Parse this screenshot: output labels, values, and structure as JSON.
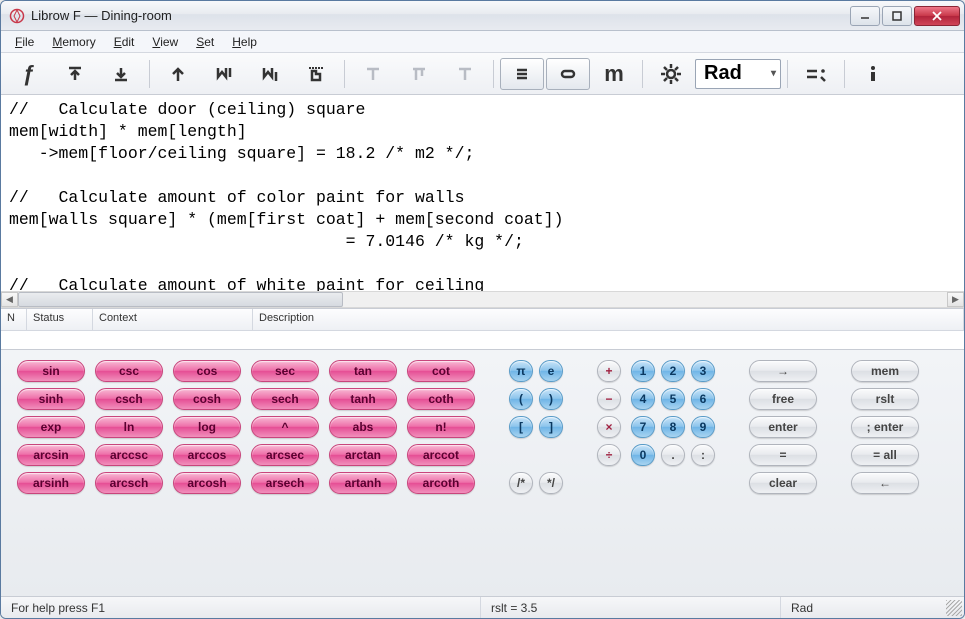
{
  "window": {
    "title": "Librow F — Dining-room"
  },
  "menu": {
    "file": "File",
    "memory": "Memory",
    "edit": "Edit",
    "view": "View",
    "set": "Set",
    "help": "Help"
  },
  "toolbar": {
    "angle_mode": "Rad"
  },
  "editor": {
    "text": "//   Calculate door (ceiling) square\nmem[width] * mem[length]\n   ->mem[floor/ceiling square] = 18.2 /* m2 */;\n\n//   Calculate amount of color paint for walls\nmem[walls square] * (mem[first coat] + mem[second coat])\n                                  = 7.0146 /* kg */;\n\n//   Calculate amount of white paint for ceiling"
  },
  "table": {
    "headers": {
      "n": "N",
      "status": "Status",
      "context": "Context",
      "description": "Description"
    }
  },
  "pad": {
    "r1": {
      "sin": "sin",
      "csc": "csc",
      "cos": "cos",
      "sec": "sec",
      "tan": "tan",
      "cot": "cot",
      "pi": "π",
      "e": "e",
      "plus": "+",
      "d1": "1",
      "d2": "2",
      "d3": "3",
      "arrow": "→",
      "mem": "mem"
    },
    "r2": {
      "sinh": "sinh",
      "csch": "csch",
      "cosh": "cosh",
      "sech": "sech",
      "tanh": "tanh",
      "coth": "coth",
      "lp": "(",
      "rp": ")",
      "minus": "−",
      "d4": "4",
      "d5": "5",
      "d6": "6",
      "free": "free",
      "rslt": "rslt"
    },
    "r3": {
      "exp": "exp",
      "ln": "ln",
      "log": "log",
      "pow": "^",
      "abs": "abs",
      "fact": "n!",
      "lb": "[",
      "rb": "]",
      "mul": "×",
      "d7": "7",
      "d8": "8",
      "d9": "9",
      "enter": "enter",
      "senter": "; enter"
    },
    "r4": {
      "arcsin": "arcsin",
      "arccsc": "arccsc",
      "arccos": "arccos",
      "arcsec": "arcsec",
      "arctan": "arctan",
      "arccot": "arccot",
      "div": "÷",
      "d0": "0",
      "dot": ".",
      "colon": ":",
      "eq": "=",
      "eqall": "= all"
    },
    "r5": {
      "arsinh": "arsinh",
      "arcsch": "arcsch",
      "arcosh": "arcosh",
      "arsech": "arsech",
      "artanh": "artanh",
      "arcoth": "arcoth",
      "lc": "/*",
      "rc": "*/",
      "clear": "clear",
      "back": "←"
    }
  },
  "status": {
    "help": "For help press F1",
    "rslt": "rslt = 3.5",
    "mode": "Rad"
  }
}
